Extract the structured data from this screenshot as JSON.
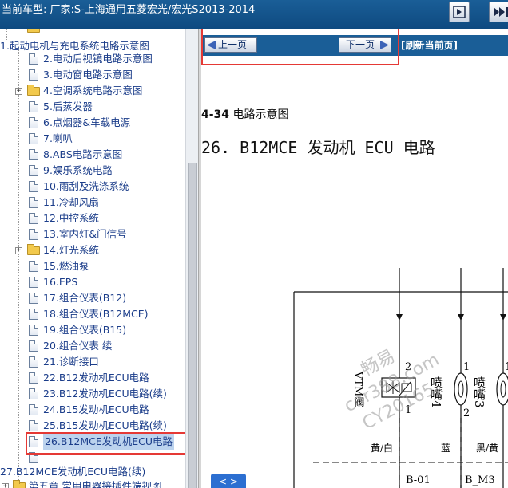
{
  "header": {
    "title": "当前车型:  厂家:S-上海通用五菱宏光/宏光S2013-2014"
  },
  "tree": {
    "root": "1.起动电机与充电系统电路示意图",
    "items": [
      {
        "label": "2.电动后视镜电路示意图",
        "type": "doc"
      },
      {
        "label": "3.电动窗电路示意图",
        "type": "doc"
      },
      {
        "label": "4.空调系统电路示意图",
        "type": "folder"
      },
      {
        "label": "5.后蒸发器",
        "type": "doc"
      },
      {
        "label": "6.点烟器&车载电源",
        "type": "doc"
      },
      {
        "label": "7.喇叭",
        "type": "doc"
      },
      {
        "label": "8.ABS电路示意图",
        "type": "doc"
      },
      {
        "label": "9.娱乐系统电路",
        "type": "doc"
      },
      {
        "label": "10.雨刮及洗涤系统",
        "type": "doc"
      },
      {
        "label": "11.冷却风扇",
        "type": "doc"
      },
      {
        "label": "12.中控系统",
        "type": "doc"
      },
      {
        "label": "13.室内灯&门信号",
        "type": "doc"
      },
      {
        "label": "14.灯光系统",
        "type": "folder"
      },
      {
        "label": "15.燃油泵",
        "type": "doc"
      },
      {
        "label": "16.EPS",
        "type": "doc"
      },
      {
        "label": "17.组合仪表(B12)",
        "type": "doc"
      },
      {
        "label": "18.组合仪表(B12MCE)",
        "type": "doc"
      },
      {
        "label": "19.组合仪表(B15)",
        "type": "doc"
      },
      {
        "label": "20.组合仪表 续",
        "type": "doc"
      },
      {
        "label": "21.诊断接口",
        "type": "doc"
      },
      {
        "label": "22.B12发动机ECU电路",
        "type": "doc"
      },
      {
        "label": "23.B12发动机ECU电路(续)",
        "type": "doc"
      },
      {
        "label": "24.B15发动机ECU电路",
        "type": "doc"
      },
      {
        "label": "25.B15发动机ECU电路(续)",
        "type": "doc"
      },
      {
        "label": "26.B12MCE发动机ECU电路",
        "type": "doc",
        "selected": true
      },
      {
        "label": "",
        "type": "doc"
      }
    ],
    "next_root": "27.B12MCE发动机ECU电路(续)",
    "chapter": "第五章 常用电器接插件端视图"
  },
  "nav": {
    "prev_label": "上一页",
    "next_label": "下一页",
    "refresh_label": "[刷新当前页]"
  },
  "content": {
    "fig_number": "4-34",
    "fig_caption": "电路示意图",
    "section_title": "26.  B12MCE 发动机 ECU 电路",
    "bubble": "< >"
  },
  "diagram": {
    "component_vtm": "VTM阀",
    "injector_4": "喷嘴4",
    "injector_3": "喷嘴3",
    "pin_2a": "2",
    "pin_1a": "1",
    "pin_1b": "1",
    "pin_2b": "2",
    "pin_1c": "1",
    "wire_1": "黄/白",
    "wire_2": "蓝",
    "wire_3": "黑/黄",
    "conn_1": "B-01",
    "conn_2": "B_M3"
  },
  "watermark": {
    "line1": "畅易",
    "line2": "car388.com",
    "line3": "CY20165"
  }
}
